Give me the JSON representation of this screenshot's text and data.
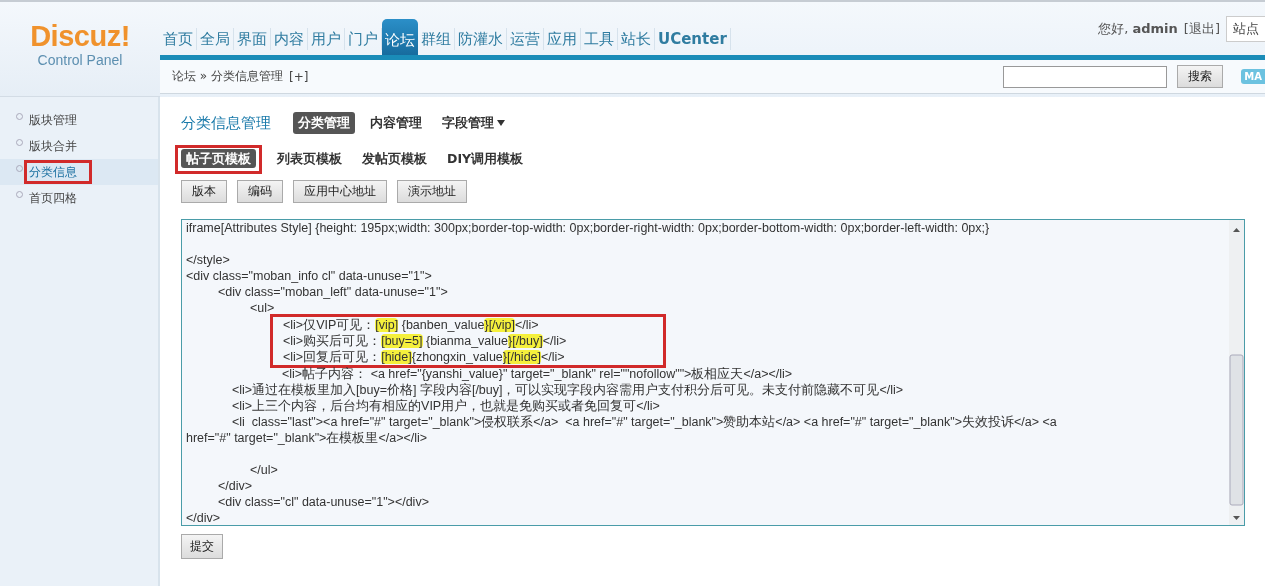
{
  "logo": {
    "name": "Discuz!",
    "subtitle": "Control Panel"
  },
  "nav": [
    {
      "label": "首页",
      "selected": false
    },
    {
      "label": "全局",
      "selected": false
    },
    {
      "label": "界面",
      "selected": false
    },
    {
      "label": "内容",
      "selected": false
    },
    {
      "label": "用户",
      "selected": false
    },
    {
      "label": "门户",
      "selected": false
    },
    {
      "label": "论坛",
      "selected": true
    },
    {
      "label": "群组",
      "selected": false
    },
    {
      "label": "防灌水",
      "selected": false
    },
    {
      "label": "运营",
      "selected": false
    },
    {
      "label": "应用",
      "selected": false
    },
    {
      "label": "工具",
      "selected": false
    },
    {
      "label": "站长",
      "selected": false
    },
    {
      "label": "UCenter",
      "selected": false
    }
  ],
  "user": {
    "greeting": "您好,",
    "name": "admin",
    "logout": "[退出]",
    "site_button": "站点"
  },
  "breadcrumb": {
    "path": "论坛",
    "separator": "»",
    "current": "分类信息管理",
    "add": "[+]"
  },
  "search": {
    "button": "搜索",
    "badge": "MA"
  },
  "sidebar": {
    "items": [
      {
        "label": "版块管理",
        "selected": false,
        "marked": false
      },
      {
        "label": "版块合并",
        "selected": false,
        "marked": false
      },
      {
        "label": "分类信息",
        "selected": true,
        "marked": true
      },
      {
        "label": "首页四格",
        "selected": false,
        "marked": false
      }
    ]
  },
  "page_title": "分类信息管理",
  "tabs": [
    {
      "label": "分类管理",
      "selected": true,
      "has_menu": false
    },
    {
      "label": "内容管理",
      "selected": false,
      "has_menu": false
    },
    {
      "label": "字段管理",
      "selected": false,
      "has_menu": true
    }
  ],
  "subtabs": [
    {
      "label": "帖子页模板",
      "selected": true,
      "marked": true
    },
    {
      "label": "列表页模板",
      "selected": false,
      "marked": false
    },
    {
      "label": "发帖页模板",
      "selected": false,
      "marked": false
    },
    {
      "label": "DIY调用模板",
      "selected": false,
      "marked": false
    }
  ],
  "buttons": [
    "版本",
    "编码",
    "应用中心地址",
    "演示地址"
  ],
  "code_lines": [
    {
      "kind": "code",
      "marked": false,
      "segments": [
        {
          "text": "iframe[Attributes Style] {height: 195px;width: 300px;border-top-width: 0px;border-right-width: 0px;border-bottom-width: 0px;border-left-width: 0px;}",
          "highlight": false
        }
      ]
    },
    {
      "kind": "blank"
    },
    {
      "kind": "code",
      "marked": false,
      "segments": [
        {
          "text": "</style>",
          "highlight": false
        }
      ]
    },
    {
      "kind": "code",
      "marked": false,
      "segments": [
        {
          "text": "<div class=\"moban_info cl\" data-unuse=\"1\">",
          "highlight": false
        }
      ]
    },
    {
      "kind": "code",
      "marked": false,
      "segments": [
        {
          "text": "\t<div class=\"moban_left\" data-unuse=\"1\">",
          "highlight": false
        }
      ]
    },
    {
      "kind": "code",
      "marked": false,
      "segments": [
        {
          "text": "\t\t<ul>",
          "highlight": false
        }
      ]
    },
    {
      "kind": "code",
      "marked": true,
      "segments": [
        {
          "text": "\t\t\t<li>仅VIP可见：",
          "highlight": false
        },
        {
          "text": "[vip]",
          "highlight": true
        },
        {
          "text": " {banben_value",
          "highlight": false
        },
        {
          "text": "}[/vip]",
          "highlight": true
        },
        {
          "text": "</li>",
          "highlight": false
        }
      ]
    },
    {
      "kind": "code",
      "marked": true,
      "segments": [
        {
          "text": "\t\t\t<li>购买后可见：",
          "highlight": false
        },
        {
          "text": "[buy=5]",
          "highlight": true
        },
        {
          "text": " {bianma_value",
          "highlight": false
        },
        {
          "text": "}[/buy]",
          "highlight": true
        },
        {
          "text": "</li>",
          "highlight": false
        }
      ]
    },
    {
      "kind": "code",
      "marked": true,
      "segments": [
        {
          "text": "\t\t\t<li>回复后可见：",
          "highlight": false
        },
        {
          "text": "[hide]",
          "highlight": true
        },
        {
          "text": "{zhongxin_value",
          "highlight": false
        },
        {
          "text": "}[/hide]",
          "highlight": true
        },
        {
          "text": "</li>",
          "highlight": false
        }
      ]
    },
    {
      "kind": "code",
      "marked": false,
      "segments": [
        {
          "text": "\t\t\t<li>帖子内容： <a href=\"{yanshi_value}\" target=\"_blank\" rel=\"\"nofollow\"\">板相应天</a></li>",
          "highlight": false
        }
      ]
    },
    {
      "kind": "code",
      "marked": false,
      "segments": [
        {
          "text": "\t    <li>通过在模板里加入[buy=价格] 字段内容[/buy]，可以实现字段内容需用户支付积分后可见。未支付前隐藏不可见</li>",
          "highlight": false
        }
      ]
    },
    {
      "kind": "code",
      "marked": false,
      "segments": [
        {
          "text": "\t    <li>上三个内容，后台均有相应的VIP用户，也就是免购买或者免回复可</li>",
          "highlight": false
        }
      ]
    },
    {
      "kind": "code",
      "marked": false,
      "segments": [
        {
          "text": "\t    <li  class=\"last\"><a href=\"#\" target=\"_blank\">侵权联系</a>  <a href=\"#\" target=\"_blank\">赞助本站</a> <a href=\"#\" target=\"_blank\">失效投诉</a> <a",
          "highlight": false
        }
      ]
    },
    {
      "kind": "code",
      "marked": false,
      "segments": [
        {
          "text": "href=\"#\" target=\"_blank\">在模板里</a></li>",
          "highlight": false
        }
      ]
    },
    {
      "kind": "blank"
    },
    {
      "kind": "code",
      "marked": false,
      "segments": [
        {
          "text": "\t\t</ul>",
          "highlight": false
        }
      ]
    },
    {
      "kind": "code",
      "marked": false,
      "segments": [
        {
          "text": "\t</div>",
          "highlight": false
        }
      ]
    },
    {
      "kind": "code",
      "marked": false,
      "segments": [
        {
          "text": "\t<div class=\"cl\" data-unuse=\"1\"></div>",
          "highlight": false
        }
      ]
    },
    {
      "kind": "code",
      "marked": false,
      "segments": [
        {
          "text": "</div>",
          "highlight": false
        }
      ]
    }
  ],
  "submit": "提交"
}
